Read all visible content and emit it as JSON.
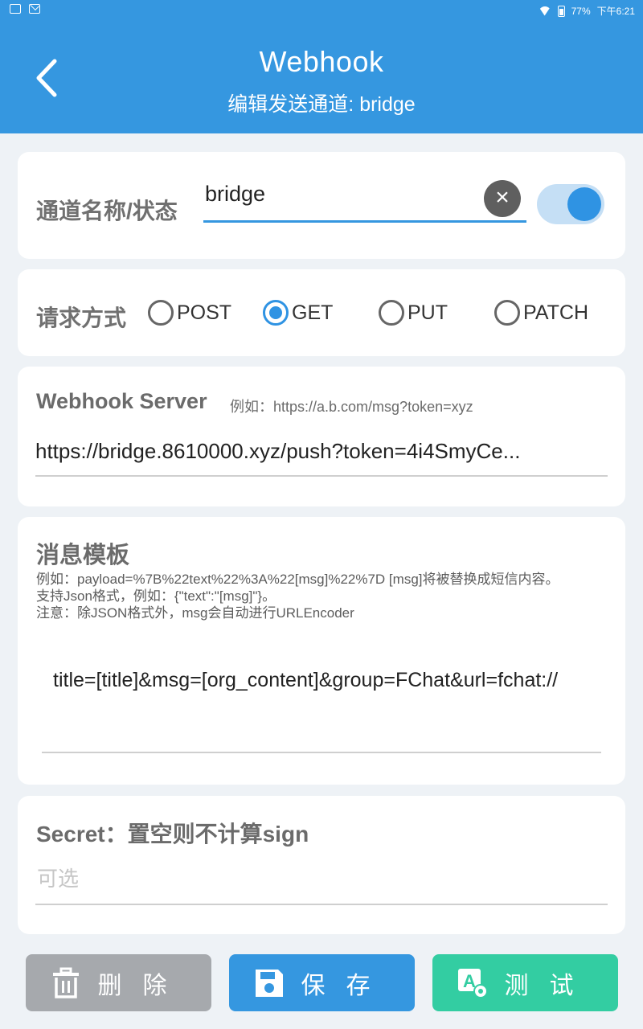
{
  "status_bar": {
    "battery": "77%",
    "time": "下午6:21"
  },
  "header": {
    "title": "Webhook",
    "subtitle": "编辑发送通道: bridge"
  },
  "channel": {
    "label": "通道名称/状态",
    "name_value": "bridge",
    "enabled": true
  },
  "method": {
    "label": "请求方式",
    "options": [
      "POST",
      "GET",
      "PUT",
      "PATCH"
    ],
    "selected": "GET"
  },
  "server": {
    "label": "Webhook Server",
    "example": "例如：https://a.b.com/msg?token=xyz",
    "value": "https://bridge.8610000.xyz/push?token=4i4SmyCe..."
  },
  "template": {
    "label": "消息模板",
    "hints": [
      "例如：payload=%7B%22text%22%3A%22[msg]%22%7D [msg]将被替换成短信内容。",
      "支持Json格式，例如：{\"text\":\"[msg]\"}。",
      "注意：除JSON格式外，msg会自动进行URLEncoder"
    ],
    "value": "title=[title]&msg=[org_content]&group=FChat&url=fchat://"
  },
  "secret": {
    "label": "Secret：置空则不计算sign",
    "placeholder": "可选",
    "value": ""
  },
  "buttons": {
    "delete": "删除",
    "save": "保存",
    "test": "测试"
  },
  "colors": {
    "primary": "#3597e0",
    "delete": "#a6a9ad",
    "test": "#33cda2"
  }
}
